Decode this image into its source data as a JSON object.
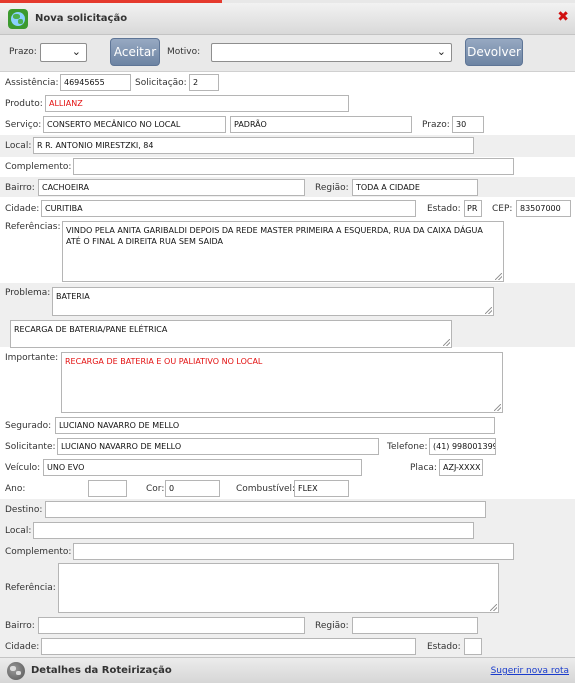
{
  "window": {
    "title": "Nova solicitação"
  },
  "toolbar": {
    "prazo_label": "Prazo:",
    "prazo_value": "",
    "aceitar_label": "Aceitar",
    "motivo_label": "Motivo:",
    "motivo_value": "",
    "devolver_label": "Devolver"
  },
  "form": {
    "assistencia": {
      "label": "Assistência:",
      "value": "46945655"
    },
    "solicitacao": {
      "label": "Solicitação:",
      "value": "2"
    },
    "produto": {
      "label": "Produto:",
      "value": "ALLIANZ"
    },
    "servico": {
      "label": "Serviço:",
      "value": "CONSERTO MECÂNICO NO LOCAL",
      "tipo": "PADRÃO"
    },
    "prazo": {
      "label": "Prazo:",
      "value": "30"
    },
    "local": {
      "label": "Local:",
      "value": "R R. ANTONIO MIRESTZKI, 84"
    },
    "complemento": {
      "label": "Complemento:",
      "value": ""
    },
    "bairro": {
      "label": "Bairro:",
      "value": "CACHOEIRA"
    },
    "regiao": {
      "label": "Região:",
      "value": "TODA A CIDADE"
    },
    "cidade": {
      "label": "Cidade:",
      "value": "CURITIBA"
    },
    "estado": {
      "label": "Estado:",
      "value": "PR"
    },
    "cep": {
      "label": "CEP:",
      "value": "83507000"
    },
    "referencias": {
      "label": "Referências:",
      "value": "VINDO PELA ANITA GARIBALDI DEPOIS DA REDE MASTER PRIMEIRA A ESQUERDA, RUA DA CAIXA DÁGUA ATÉ  O FINAL A DIREITA RUA SEM SAIDA"
    },
    "problema": {
      "label": "Problema:",
      "value": "BATERIA"
    },
    "problema_detalhe": {
      "value": "RECARGA DE BATERIA/PANE ELÉTRICA"
    },
    "importante": {
      "label": "Importante:",
      "value": "RECARGA DE BATERIA E OU PALIATIVO NO LOCAL"
    },
    "segurado": {
      "label": "Segurado:",
      "value": "LUCIANO NAVARRO DE MELLO"
    },
    "solicitante": {
      "label": "Solicitante:",
      "value": "LUCIANO NAVARRO DE MELLO"
    },
    "telefone": {
      "label": "Telefone:",
      "value": "(41) 998001399"
    },
    "veiculo": {
      "label": "Veículo:",
      "value": "UNO EVO"
    },
    "placa": {
      "label": "Placa:",
      "value": "AZJ-XXXX"
    },
    "ano": {
      "label": "Ano:",
      "value": ""
    },
    "cor": {
      "label": "Cor:",
      "value": "0"
    },
    "combustivel": {
      "label": "Combustível:",
      "value": "FLEX"
    }
  },
  "destino": {
    "destino": {
      "label": "Destino:",
      "value": ""
    },
    "local": {
      "label": "Local:",
      "value": ""
    },
    "complemento": {
      "label": "Complemento:",
      "value": ""
    },
    "referencia": {
      "label": "Referência:",
      "value": ""
    },
    "bairro": {
      "label": "Bairro:",
      "value": ""
    },
    "regiao": {
      "label": "Região:",
      "value": ""
    },
    "cidade": {
      "label": "Cidade:",
      "value": ""
    },
    "estado": {
      "label": "Estado:",
      "value": ""
    }
  },
  "footer": {
    "title": "Detalhes da Roteirização",
    "link": "Sugerir nova rota"
  }
}
